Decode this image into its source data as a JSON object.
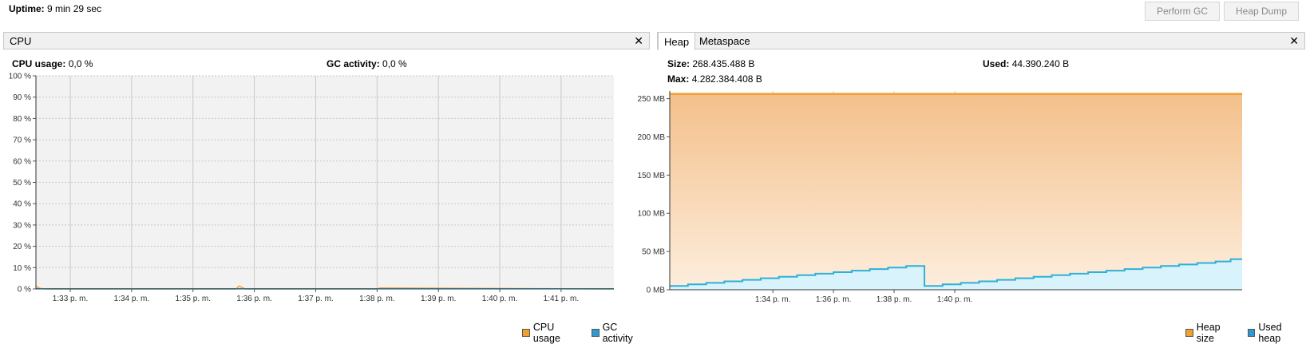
{
  "header": {
    "uptime_label": "Uptime:",
    "uptime_value": "9 min 29 sec",
    "perform_gc_label": "Perform GC",
    "heap_dump_label": "Heap Dump"
  },
  "cpu_panel": {
    "tab_label": "CPU",
    "close_glyph": "✕",
    "cpu_usage_label": "CPU usage:",
    "cpu_usage_value": "0,0 %",
    "gc_activity_label": "GC activity:",
    "gc_activity_value": "0,0 %",
    "legend": [
      {
        "label": "CPU usage",
        "color": "#f0a030"
      },
      {
        "label": "GC activity",
        "color": "#2e9ad0"
      }
    ]
  },
  "heap_panel": {
    "tabs": [
      {
        "label": "Heap"
      },
      {
        "label": "Metaspace"
      }
    ],
    "close_glyph": "✕",
    "size_label": "Size:",
    "size_value": "268.435.488 B",
    "used_label": "Used:",
    "used_value": "44.390.240 B",
    "max_label": "Max:",
    "max_value": "4.282.384.408 B",
    "legend": [
      {
        "label": "Heap size",
        "color": "#f0a030"
      },
      {
        "label": "Used heap",
        "color": "#2e9ad0"
      }
    ]
  },
  "colors": {
    "orange": "#f0a030",
    "blue": "#2eb0d8",
    "grid": "#c8c8c8"
  },
  "chart_data": [
    {
      "type": "line",
      "ylim": [
        0,
        100
      ],
      "xlim": [
        -0.56,
        8.86
      ],
      "y_ticks": [
        "0 %",
        "10 %",
        "20 %",
        "30 %",
        "40 %",
        "50 %",
        "60 %",
        "70 %",
        "80 %",
        "90 %",
        "100 %"
      ],
      "x_ticks": [
        "1:33 p. m.",
        "1:34 p. m.",
        "1:35 p. m.",
        "1:36 p. m.",
        "1:37 p. m.",
        "1:38 p. m.",
        "1:39 p. m.",
        "1:40 p. m.",
        "1:41 p. m."
      ],
      "series": [
        {
          "name": "CPU usage",
          "x": [
            -0.56,
            -0.5,
            -0.4,
            0,
            0.1,
            2.7,
            2.75,
            2.85,
            3.0,
            5.0,
            5.05,
            8.86
          ],
          "values": [
            1.2,
            0.3,
            0,
            0,
            0,
            0,
            1.3,
            0,
            0,
            0,
            0.4,
            0
          ]
        },
        {
          "name": "GC activity",
          "x": [
            -0.56,
            8.86
          ],
          "values": [
            0,
            0
          ]
        }
      ]
    },
    {
      "type": "area",
      "ylim": [
        0,
        260
      ],
      "xlim": [
        -1.7,
        7.74
      ],
      "y_ticks": [
        "0 MB",
        "50 MB",
        "100 MB",
        "150 MB",
        "200 MB",
        "250 MB"
      ],
      "x_ticks": [
        "1:34 p. m.",
        "1:36 p. m.",
        "1:38 p. m.",
        "1:40 p. m."
      ],
      "series": [
        {
          "name": "Heap size",
          "x": [
            -1.7,
            7.74
          ],
          "values": [
            256,
            256
          ]
        },
        {
          "name": "Used heap",
          "x": [
            -1.7,
            -1.4,
            -1.4,
            -1.1,
            -1.1,
            -0.8,
            -0.8,
            -0.5,
            -0.5,
            -0.2,
            -0.2,
            0.1,
            0.1,
            0.4,
            0.4,
            0.7,
            0.7,
            1.0,
            1.0,
            1.3,
            1.3,
            1.6,
            1.6,
            1.9,
            1.9,
            2.2,
            2.2,
            2.5,
            2.5,
            2.8,
            2.8,
            3.1,
            3.1,
            3.4,
            3.4,
            3.7,
            3.7,
            4.0,
            4.0,
            4.3,
            4.3,
            4.6,
            4.6,
            4.9,
            4.9,
            5.2,
            5.2,
            5.5,
            5.5,
            5.8,
            5.8,
            6.1,
            6.1,
            6.4,
            6.4,
            6.7,
            6.7,
            7.0,
            7.0,
            7.3,
            7.3,
            7.55,
            7.55,
            7.74
          ],
          "values": [
            5,
            5,
            7,
            7,
            9,
            9,
            11,
            11,
            13,
            13,
            15,
            15,
            17,
            17,
            19,
            19,
            21,
            21,
            23,
            23,
            25,
            25,
            27,
            27,
            29,
            29,
            31,
            31,
            5,
            5,
            7,
            7,
            9,
            9,
            11,
            11,
            13,
            13,
            15,
            15,
            17,
            17,
            19,
            19,
            21,
            21,
            23,
            23,
            25,
            25,
            27,
            27,
            29,
            29,
            31,
            31,
            33,
            33,
            35,
            35,
            37,
            37,
            40,
            40
          ]
        }
      ]
    }
  ]
}
